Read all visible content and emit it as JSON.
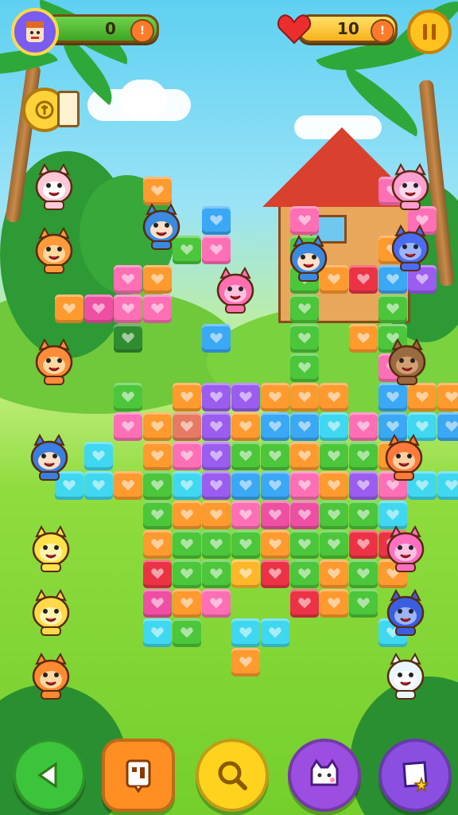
{
  "hud": {
    "score_value": "0",
    "lives_value": "10",
    "player_avatar": "avatar-icon",
    "pause_icon": "pause-icon",
    "coin_icon": "coin-icon",
    "heart_icon": "heart-icon"
  },
  "bottom_bar": [
    {
      "name": "back-button",
      "icon": "arrow-left-icon",
      "color": "#3cc43a"
    },
    {
      "name": "card-button",
      "icon": "card-icon",
      "color": "#ff8f22"
    },
    {
      "name": "search-button",
      "icon": "magnifier-icon",
      "color": "#ffd21e"
    },
    {
      "name": "pet-button",
      "icon": "cat-face-icon",
      "color": "#9b4ee0"
    },
    {
      "name": "map-star-button",
      "icon": "map-star-icon",
      "color": "#8a4fe0"
    }
  ],
  "palette": {
    "orange": "#ff9a2e",
    "pink": "#ff6fb5",
    "magenta": "#ef4fa2",
    "purple": "#9b5cf0",
    "blue": "#3aa8f5",
    "cyan": "#3fd8f0",
    "green": "#4cc63a",
    "red": "#ec3346",
    "yellow": "#ffb72a",
    "darkgreen": "#2f8d2f",
    "salmon": "#e77a62"
  },
  "grid": [
    {
      "c": "orange",
      "col": 4,
      "row": 0
    },
    {
      "c": "blue",
      "col": 6,
      "row": 1
    },
    {
      "c": "pink",
      "col": 9,
      "row": 1
    },
    {
      "c": "pink",
      "col": 12,
      "row": 0
    },
    {
      "c": "green",
      "col": 5,
      "row": 2
    },
    {
      "c": "pink",
      "col": 6,
      "row": 2
    },
    {
      "c": "green",
      "col": 9,
      "row": 2
    },
    {
      "c": "orange",
      "col": 12,
      "row": 2
    },
    {
      "c": "pink",
      "col": 13,
      "row": 1
    },
    {
      "c": "pink",
      "col": 3,
      "row": 3
    },
    {
      "c": "orange",
      "col": 4,
      "row": 3
    },
    {
      "c": "green",
      "col": 9,
      "row": 3
    },
    {
      "c": "orange",
      "col": 10,
      "row": 3
    },
    {
      "c": "red",
      "col": 11,
      "row": 3
    },
    {
      "c": "blue",
      "col": 12,
      "row": 3
    },
    {
      "c": "purple",
      "col": 13,
      "row": 3
    },
    {
      "c": "orange",
      "col": 1,
      "row": 4
    },
    {
      "c": "magenta",
      "col": 2,
      "row": 4
    },
    {
      "c": "pink",
      "col": 3,
      "row": 4
    },
    {
      "c": "pink",
      "col": 4,
      "row": 4
    },
    {
      "c": "green",
      "col": 9,
      "row": 4
    },
    {
      "c": "green",
      "col": 12,
      "row": 4
    },
    {
      "c": "darkgreen",
      "col": 3,
      "row": 5
    },
    {
      "c": "blue",
      "col": 6,
      "row": 5
    },
    {
      "c": "green",
      "col": 9,
      "row": 5
    },
    {
      "c": "orange",
      "col": 11,
      "row": 5
    },
    {
      "c": "green",
      "col": 12,
      "row": 5
    },
    {
      "c": "pink",
      "col": 12,
      "row": 6
    },
    {
      "c": "green",
      "col": 9,
      "row": 6
    },
    {
      "c": "green",
      "col": 3,
      "row": 7
    },
    {
      "c": "orange",
      "col": 5,
      "row": 7
    },
    {
      "c": "purple",
      "col": 6,
      "row": 7
    },
    {
      "c": "purple",
      "col": 7,
      "row": 7
    },
    {
      "c": "orange",
      "col": 8,
      "row": 7
    },
    {
      "c": "orange",
      "col": 9,
      "row": 7
    },
    {
      "c": "orange",
      "col": 10,
      "row": 7
    },
    {
      "c": "blue",
      "col": 12,
      "row": 7
    },
    {
      "c": "orange",
      "col": 13,
      "row": 7
    },
    {
      "c": "orange",
      "col": 14,
      "row": 7
    },
    {
      "c": "pink",
      "col": 3,
      "row": 8
    },
    {
      "c": "orange",
      "col": 4,
      "row": 8
    },
    {
      "c": "salmon",
      "col": 5,
      "row": 8
    },
    {
      "c": "purple",
      "col": 6,
      "row": 8
    },
    {
      "c": "orange",
      "col": 7,
      "row": 8
    },
    {
      "c": "blue",
      "col": 8,
      "row": 8
    },
    {
      "c": "blue",
      "col": 9,
      "row": 8
    },
    {
      "c": "cyan",
      "col": 10,
      "row": 8
    },
    {
      "c": "pink",
      "col": 11,
      "row": 8
    },
    {
      "c": "blue",
      "col": 12,
      "row": 8
    },
    {
      "c": "cyan",
      "col": 13,
      "row": 8
    },
    {
      "c": "blue",
      "col": 14,
      "row": 8
    },
    {
      "c": "cyan",
      "col": 2,
      "row": 9
    },
    {
      "c": "orange",
      "col": 4,
      "row": 9
    },
    {
      "c": "pink",
      "col": 5,
      "row": 9
    },
    {
      "c": "purple",
      "col": 6,
      "row": 9
    },
    {
      "c": "green",
      "col": 7,
      "row": 9
    },
    {
      "c": "green",
      "col": 8,
      "row": 9
    },
    {
      "c": "orange",
      "col": 9,
      "row": 9
    },
    {
      "c": "green",
      "col": 10,
      "row": 9
    },
    {
      "c": "green",
      "col": 11,
      "row": 9
    },
    {
      "c": "orange",
      "col": 12,
      "row": 9
    },
    {
      "c": "cyan",
      "col": 1,
      "row": 10
    },
    {
      "c": "cyan",
      "col": 2,
      "row": 10
    },
    {
      "c": "orange",
      "col": 3,
      "row": 10
    },
    {
      "c": "green",
      "col": 4,
      "row": 10
    },
    {
      "c": "cyan",
      "col": 5,
      "row": 10
    },
    {
      "c": "purple",
      "col": 6,
      "row": 10
    },
    {
      "c": "blue",
      "col": 7,
      "row": 10
    },
    {
      "c": "blue",
      "col": 8,
      "row": 10
    },
    {
      "c": "pink",
      "col": 9,
      "row": 10
    },
    {
      "c": "orange",
      "col": 10,
      "row": 10
    },
    {
      "c": "purple",
      "col": 11,
      "row": 10
    },
    {
      "c": "pink",
      "col": 12,
      "row": 10
    },
    {
      "c": "cyan",
      "col": 13,
      "row": 10
    },
    {
      "c": "cyan",
      "col": 14,
      "row": 10
    },
    {
      "c": "green",
      "col": 4,
      "row": 11
    },
    {
      "c": "orange",
      "col": 5,
      "row": 11
    },
    {
      "c": "orange",
      "col": 6,
      "row": 11
    },
    {
      "c": "pink",
      "col": 7,
      "row": 11
    },
    {
      "c": "magenta",
      "col": 8,
      "row": 11
    },
    {
      "c": "magenta",
      "col": 9,
      "row": 11
    },
    {
      "c": "green",
      "col": 10,
      "row": 11
    },
    {
      "c": "green",
      "col": 11,
      "row": 11
    },
    {
      "c": "cyan",
      "col": 12,
      "row": 11
    },
    {
      "c": "orange",
      "col": 4,
      "row": 12
    },
    {
      "c": "green",
      "col": 5,
      "row": 12
    },
    {
      "c": "green",
      "col": 6,
      "row": 12
    },
    {
      "c": "green",
      "col": 7,
      "row": 12
    },
    {
      "c": "orange",
      "col": 8,
      "row": 12
    },
    {
      "c": "green",
      "col": 9,
      "row": 12
    },
    {
      "c": "green",
      "col": 10,
      "row": 12
    },
    {
      "c": "red",
      "col": 11,
      "row": 12
    },
    {
      "c": "red",
      "col": 12,
      "row": 12
    },
    {
      "c": "red",
      "col": 4,
      "row": 13
    },
    {
      "c": "green",
      "col": 5,
      "row": 13
    },
    {
      "c": "green",
      "col": 6,
      "row": 13
    },
    {
      "c": "yellow",
      "col": 7,
      "row": 13
    },
    {
      "c": "red",
      "col": 8,
      "row": 13
    },
    {
      "c": "green",
      "col": 9,
      "row": 13
    },
    {
      "c": "orange",
      "col": 10,
      "row": 13
    },
    {
      "c": "green",
      "col": 11,
      "row": 13
    },
    {
      "c": "orange",
      "col": 12,
      "row": 13
    },
    {
      "c": "magenta",
      "col": 4,
      "row": 14
    },
    {
      "c": "orange",
      "col": 5,
      "row": 14
    },
    {
      "c": "pink",
      "col": 6,
      "row": 14
    },
    {
      "c": "red",
      "col": 9,
      "row": 14
    },
    {
      "c": "orange",
      "col": 10,
      "row": 14
    },
    {
      "c": "green",
      "col": 11,
      "row": 14
    },
    {
      "c": "cyan",
      "col": 4,
      "row": 15
    },
    {
      "c": "green",
      "col": 5,
      "row": 15
    },
    {
      "c": "cyan",
      "col": 7,
      "row": 15
    },
    {
      "c": "cyan",
      "col": 8,
      "row": 15
    },
    {
      "c": "cyan",
      "col": 12,
      "row": 15
    },
    {
      "c": "orange",
      "col": 7,
      "row": 16
    }
  ],
  "characters": [
    {
      "name": "pink-cat-character",
      "body": "#ffc8d8",
      "face": "#fff"
    },
    {
      "name": "orange-bear-character",
      "body": "#ff9a3a",
      "face": "#ffd9a0"
    },
    {
      "name": "orange-cat-character",
      "body": "#ff8c3a",
      "face": "#ffd9a0"
    },
    {
      "name": "girl-character",
      "body": "#3a7fe0",
      "face": "#ffe0c8"
    },
    {
      "name": "yellow-cat-character",
      "body": "#ffe24a",
      "face": "#fff5b0"
    },
    {
      "name": "yellow-bear-character",
      "body": "#ffd94a",
      "face": "#fff5b0"
    },
    {
      "name": "orange-fox-character",
      "body": "#ff8a32",
      "face": "#ffd9a0"
    },
    {
      "name": "pink-blob-character",
      "body": "#ff9ed0",
      "face": "#ffd9ec"
    },
    {
      "name": "blue-robot-character",
      "body": "#4a6cf0",
      "face": "#9ab4ff"
    },
    {
      "name": "brown-bear-character",
      "body": "#9a6a40",
      "face": "#d0a070"
    },
    {
      "name": "orange-fish-character",
      "body": "#ff7a3a",
      "face": "#ffd0a0"
    },
    {
      "name": "pink-robot-character",
      "body": "#ff6fc0",
      "face": "#ffc0e4"
    },
    {
      "name": "blue-robot-2-character",
      "body": "#3a5ee0",
      "face": "#9ab4ff"
    },
    {
      "name": "white-cat-character",
      "body": "#e8f6ff",
      "face": "#ffffff"
    },
    {
      "name": "pink-dragon-character",
      "body": "#ff6fb0",
      "face": "#ffc0e0"
    },
    {
      "name": "boy-character",
      "body": "#3a8ae0",
      "face": "#ffe0c8"
    },
    {
      "name": "boy-2-character",
      "body": "#3a8ae0",
      "face": "#ffe0c8"
    }
  ]
}
